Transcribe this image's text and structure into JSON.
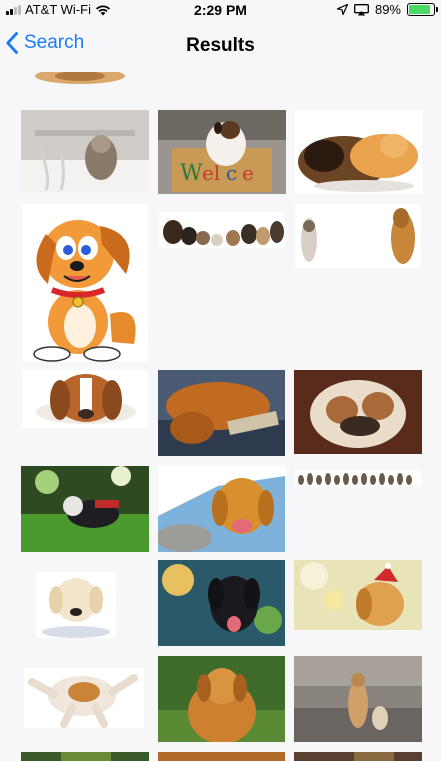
{
  "status_bar": {
    "carrier": "AT&T Wi-Fi",
    "time": "2:29 PM",
    "battery_percent": "89%",
    "battery_level": 0.89,
    "icons": [
      "signal-icon",
      "wifi-icon",
      "location-icon",
      "airplay-icon",
      "battery-icon"
    ]
  },
  "nav": {
    "back_label": "Search",
    "title": "Results"
  },
  "colors": {
    "accent": "#1a7cf5",
    "battery_green": "#4cd964",
    "background": "#f7f7fa"
  }
}
